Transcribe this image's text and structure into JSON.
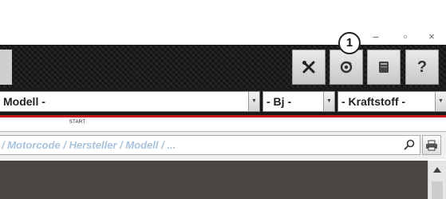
{
  "window": {
    "minimize_glyph": "–",
    "maximize_glyph": "▫",
    "close_glyph": "×"
  },
  "toolbar": {
    "buttons": [
      {
        "name": "tools-button",
        "icon": "wrench-screwdriver-icon"
      },
      {
        "name": "sync-button",
        "icon": "sync-icon"
      },
      {
        "name": "book-button",
        "icon": "book-icon"
      },
      {
        "name": "help-button",
        "icon": "help-icon",
        "label": "?"
      }
    ]
  },
  "callout": {
    "number": "1"
  },
  "filters": {
    "modell": "Modell -",
    "baujahr": "- Bj -",
    "kraftstoff": "- Kraftstoff -"
  },
  "tabs": {
    "start": "START"
  },
  "search": {
    "placeholder": "/ Motorcode / Hersteller / Modell / ..."
  },
  "colors": {
    "accent_red": "#c41a1a",
    "toolbar_carbon": "#1b1b1b",
    "content_bg": "#4a4443",
    "search_placeholder": "#a9c2dc"
  }
}
